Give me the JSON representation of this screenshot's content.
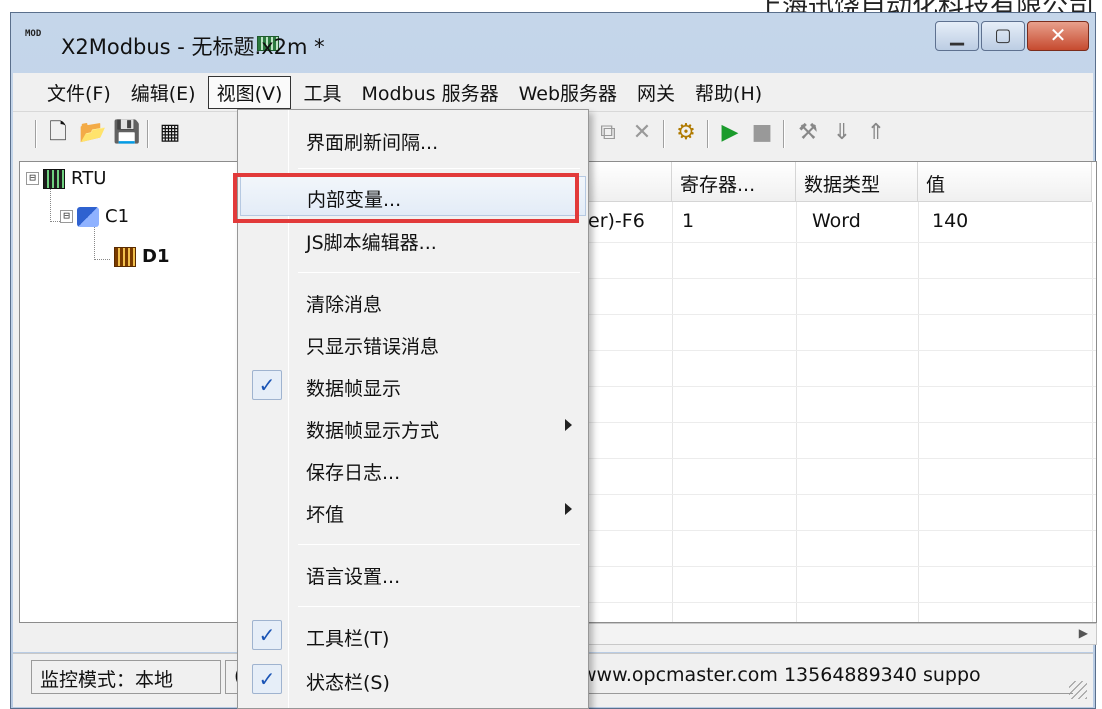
{
  "watermark_text": "上海迅饶自动化科技有限公司",
  "window": {
    "app_icon_text": "MOD",
    "title": "X2Modbus - 无标题.x2m *"
  },
  "menubar": {
    "items": [
      "文件(F)",
      "编辑(E)",
      "视图(V)",
      "工具",
      "Modbus 服务器",
      "Web服务器",
      "网关",
      "帮助(H)"
    ]
  },
  "tree": {
    "nodes": [
      {
        "label": "RTU",
        "icon": "rtu-icon",
        "expander": "⊟"
      },
      {
        "label": "C1",
        "icon": "connection-icon",
        "expander": "⊟"
      },
      {
        "label": "D1",
        "icon": "device-icon",
        "expander": ""
      }
    ]
  },
  "grid": {
    "columns": [
      "",
      "寄存器...",
      "数据类型",
      "值"
    ],
    "rows": [
      {
        "name_partial": "er)-F6",
        "register": "1",
        "type": "Word",
        "value": "140"
      }
    ]
  },
  "statusbar": {
    "mode": "监控模式：本地",
    "pane2": "(",
    "info": "www.opcmaster.com 13564889340 suppo"
  },
  "view_menu": {
    "items": [
      {
        "label": "界面刷新间隔...",
        "checked": false,
        "submenu": false
      },
      {
        "label": "内部变量...",
        "checked": false,
        "submenu": false,
        "highlighted": true
      },
      {
        "label": "JS脚本编辑器...",
        "checked": false,
        "submenu": false
      },
      {
        "label": "清除消息",
        "checked": false,
        "submenu": false
      },
      {
        "label": "只显示错误消息",
        "checked": false,
        "submenu": false
      },
      {
        "label": "数据帧显示",
        "checked": true,
        "submenu": false
      },
      {
        "label": "数据帧显示方式",
        "checked": false,
        "submenu": true
      },
      {
        "label": "保存日志...",
        "checked": false,
        "submenu": false
      },
      {
        "label": "坏值",
        "checked": false,
        "submenu": true
      },
      {
        "label": "语言设置...",
        "checked": false,
        "submenu": false
      },
      {
        "label": "工具栏(T)",
        "checked": true,
        "submenu": false
      },
      {
        "label": "状态栏(S)",
        "checked": true,
        "submenu": false
      }
    ],
    "check_glyph": "✓"
  },
  "colors": {
    "highlight_border": "#e23a3a",
    "check": "#1a54b5"
  }
}
